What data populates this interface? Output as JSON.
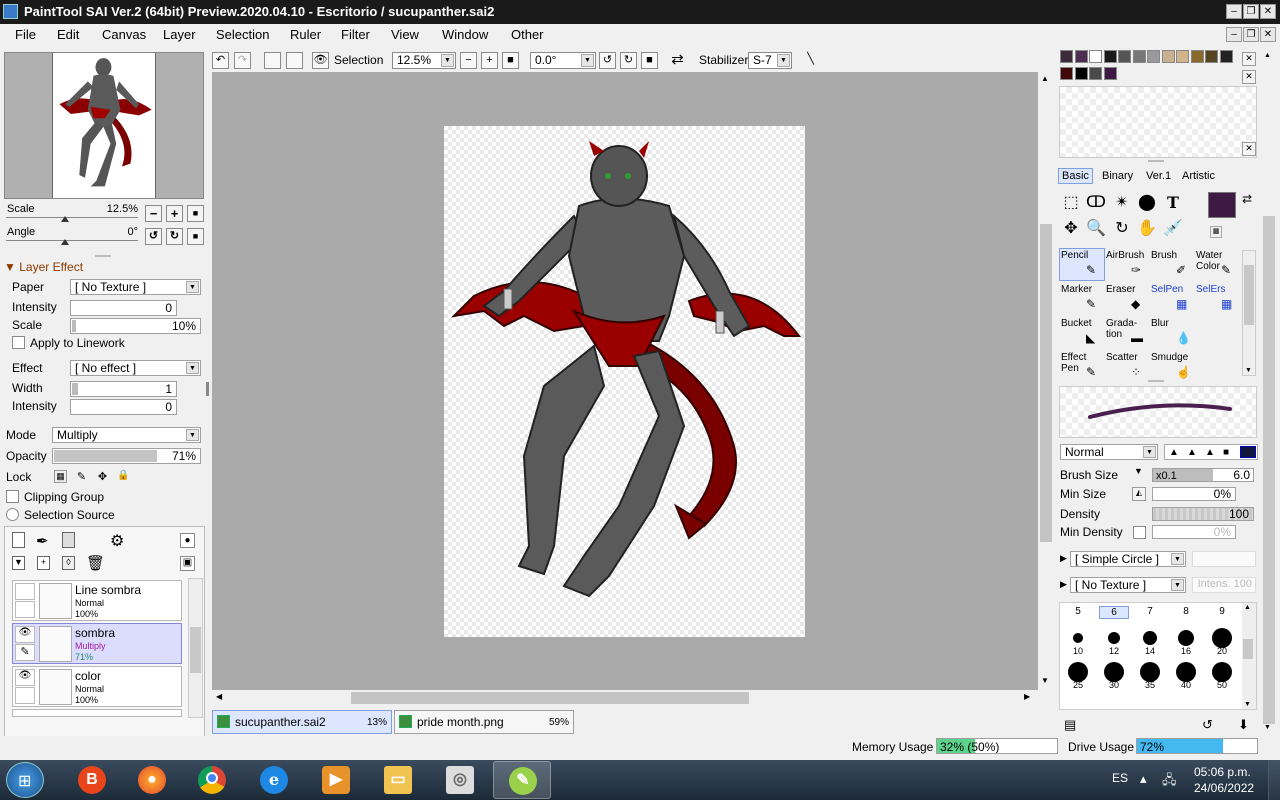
{
  "window": {
    "title": "PaintTool SAI Ver.2 (64bit) Preview.2020.04.10 - Escritorio / sucupanther.sai2",
    "min": "‒",
    "max": "❐",
    "close": "✕"
  },
  "menu": [
    "File",
    "Edit",
    "Canvas",
    "Layer",
    "Selection",
    "Ruler",
    "Filter",
    "View",
    "Window",
    "Other"
  ],
  "toolbar": {
    "selection_label": "Selection",
    "zoom": "12.5%",
    "angle": "0.0°",
    "stabilizer_label": "Stabilizer",
    "stabilizer_value": "S-7"
  },
  "navigator": {
    "scale_label": "Scale",
    "scale_value": "12.5%",
    "scale_level": 0.45,
    "angle_label": "Angle",
    "angle_value": "0°",
    "angle_level": 0.45
  },
  "layer_effect": {
    "header": "Layer Effect",
    "paper_label": "Paper",
    "paper_value": "[ No Texture ]",
    "intensity_label": "Intensity",
    "intensity_value": "0",
    "scale_label": "Scale",
    "scale_value": "10%",
    "apply_linework": "Apply to Linework",
    "effect_label": "Effect",
    "effect_value": "[ No effect ]",
    "width_label": "Width",
    "width_value": "1",
    "intensity2_label": "Intensity",
    "intensity2_value": "0"
  },
  "layer_props": {
    "mode_label": "Mode",
    "mode_value": "Multiply",
    "opacity_label": "Opacity",
    "opacity_value": "71%",
    "opacity_level": 0.71,
    "lock_label": "Lock",
    "clipping_group": "Clipping Group",
    "selection_source": "Selection Source"
  },
  "layers": [
    {
      "name": "Line sombra",
      "mode": "Normal",
      "opacity": "100%",
      "visible": false,
      "selected": false
    },
    {
      "name": "sombra",
      "mode": "Multiply",
      "opacity": "71%",
      "visible": true,
      "selected": true
    },
    {
      "name": "color",
      "mode": "Normal",
      "opacity": "100%",
      "visible": true,
      "selected": false
    }
  ],
  "documents": [
    {
      "name": "sucupanther.sai2",
      "percent": "13%",
      "selected": true
    },
    {
      "name": "pride month.png",
      "percent": "59%",
      "selected": false
    }
  ],
  "colors": {
    "current": "#3d1a42",
    "palette_row1": [
      "#3a2a3a",
      "#4d2e52",
      "#ffffff",
      "#1a1a1a",
      "#555555",
      "#777777",
      "#999999",
      "#c8b090",
      "#d2b48c",
      "#8a6a2a",
      "#554422",
      "#222222"
    ],
    "palette_row2": [
      "#400808",
      "#000000",
      "#4a4a4a",
      "#3d1a42"
    ]
  },
  "tool_tabs": [
    "Basic",
    "Binary",
    "Ver.1",
    "Artistic"
  ],
  "brushes": [
    {
      "name": "Pencil",
      "icon": "✎",
      "selected": true,
      "blue": false
    },
    {
      "name": "AirBrush",
      "icon": "✑",
      "selected": false,
      "blue": false
    },
    {
      "name": "Brush",
      "icon": "✐",
      "selected": false,
      "blue": false
    },
    {
      "name": "Water Color",
      "icon": "✎",
      "selected": false,
      "blue": false
    },
    {
      "name": "Marker",
      "icon": "✎",
      "selected": false,
      "blue": false
    },
    {
      "name": "Eraser",
      "icon": "◆",
      "selected": false,
      "blue": false
    },
    {
      "name": "SelPen",
      "icon": "▦",
      "selected": false,
      "blue": true
    },
    {
      "name": "SelErs",
      "icon": "▦",
      "selected": false,
      "blue": true
    },
    {
      "name": "Bucket",
      "icon": "◣",
      "selected": false,
      "blue": false
    },
    {
      "name": "Grada- tion",
      "icon": "▬",
      "selected": false,
      "blue": false
    },
    {
      "name": "Blur",
      "icon": "💧",
      "selected": false,
      "blue": false
    },
    {
      "name": "",
      "icon": "",
      "selected": false,
      "blue": false
    },
    {
      "name": "Effect Pen",
      "icon": "✎",
      "selected": false,
      "blue": false
    },
    {
      "name": "Scatter",
      "icon": "⁘",
      "selected": false,
      "blue": false
    },
    {
      "name": "Smudge",
      "icon": "☝",
      "selected": false,
      "blue": false
    },
    {
      "name": "",
      "icon": "",
      "selected": false,
      "blue": false
    }
  ],
  "brush_settings": {
    "blend_mode": "Normal",
    "brush_size_label": "Brush Size",
    "brush_size_mult": "x0.1",
    "brush_size_value": "6.0",
    "min_size_label": "Min Size",
    "min_size_value": "0%",
    "density_label": "Density",
    "density_value": "100",
    "min_density_label": "Min Density",
    "min_density_value": "0%",
    "shape": "[ Simple Circle ]",
    "texture": "[ No Texture ]",
    "texture_intensity": "Intens. 100"
  },
  "brush_sizes": {
    "header": [
      "5",
      "6",
      "7",
      "8",
      "9"
    ],
    "row1": [
      "10",
      "12",
      "14",
      "16",
      "20"
    ],
    "row2": [
      "25",
      "30",
      "35",
      "40",
      "50"
    ]
  },
  "status": {
    "memory_label": "Memory Usage",
    "memory_value": "32% (50%)",
    "memory_level": 0.32,
    "drive_label": "Drive Usage",
    "drive_value": "72%",
    "drive_level": 0.72
  },
  "taskbar": {
    "lang": "ES",
    "time": "05:06 p.m.",
    "date": "24/06/2022"
  }
}
